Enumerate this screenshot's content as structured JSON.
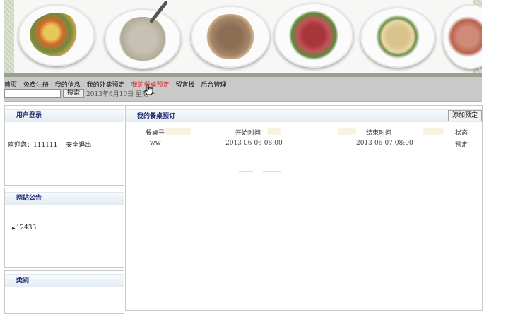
{
  "nav": {
    "links": [
      "首页",
      "免费注册",
      "我的信息",
      "我的外卖预定",
      "我的餐桌预定",
      "留言板",
      "后台管理"
    ],
    "active_index": 4,
    "search_button": "搜索",
    "search_value": "",
    "date_text": "2013年6月10日 星期一"
  },
  "login_box": {
    "title": "用户登录",
    "welcome": "欢迎您：111111",
    "logout": "安全退出"
  },
  "notice_box": {
    "title": "网站公告",
    "items": [
      "12433"
    ]
  },
  "category_box": {
    "title": "类别"
  },
  "main": {
    "title": "我的餐桌预订",
    "add_button": "添加预定",
    "columns": [
      "餐桌号",
      "开始时间",
      "结束时间",
      "状态"
    ],
    "rows": [
      [
        "ww",
        "2013-06-06 08:00",
        "2013-06-07 08:00",
        "预定"
      ]
    ]
  },
  "colors": {
    "active_link": "#e02a2a",
    "box_title": "#1d2b72",
    "nav_bg": "#c9c9c9"
  }
}
